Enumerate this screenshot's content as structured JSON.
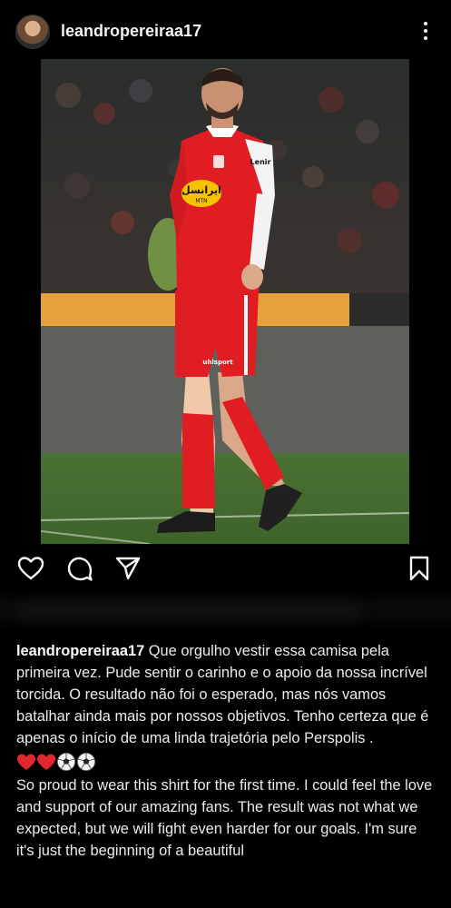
{
  "post": {
    "username": "leandropereiraa17",
    "caption_pt": "Que orgulho vestir essa camisa pela primeira vez. Pude sentir o carinho e o apoio da nossa incrível torcida. O resultado não foi o esperado, mas nós vamos batalhar ainda mais por nossos objetivos. Tenho certeza que é apenas o início de uma linda trajetória pelo Perspolis .",
    "caption_en": "So proud to wear this shirt for the first time.  I could feel the love and support of our amazing fans.  The result was not what we expected, but we will fight even harder for our goals.  I'm sure it's just the beginning of a beautiful",
    "emojis": [
      "red-heart",
      "red-heart",
      "soccer-ball",
      "soccer-ball"
    ]
  },
  "photo": {
    "jersey_sponsor": "ایرانسل",
    "jersey_sponsor_sub": "MTN",
    "sleeve_brand": "Lenir",
    "shorts_brand": "uhlsport"
  },
  "icons": {
    "like": "heart-outline-icon",
    "comment": "comment-bubble-icon",
    "share": "paper-plane-icon",
    "save": "bookmark-outline-icon",
    "more": "vertical-dots-icon"
  },
  "colors": {
    "background": "#000000",
    "jersey_red": "#e11d24",
    "pitch_green": "#4f7a36",
    "sponsor_yellow": "#f5c400"
  }
}
